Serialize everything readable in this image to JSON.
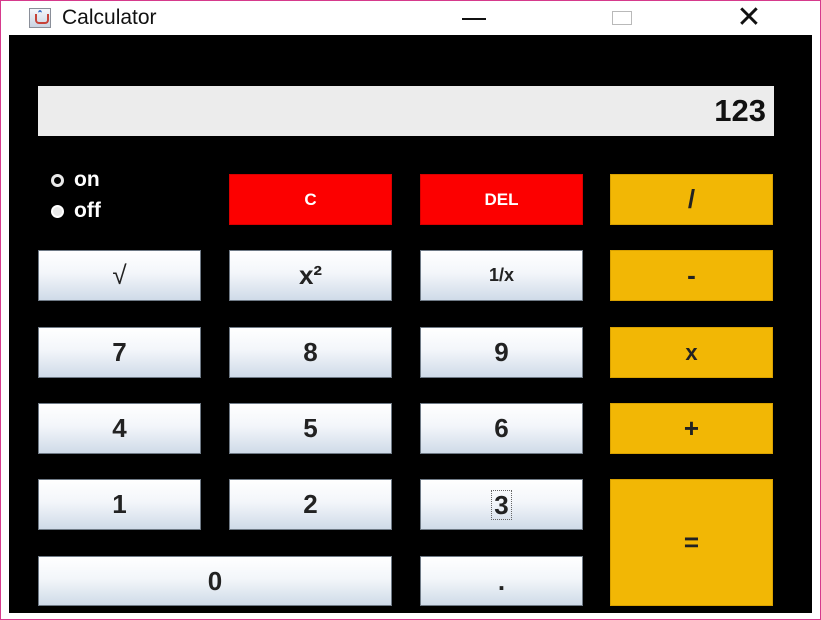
{
  "window": {
    "title": "Calculator",
    "minimize_glyph": "",
    "close_glyph": "✕"
  },
  "display": {
    "value": "123"
  },
  "power": {
    "on_label": "on",
    "off_label": "off",
    "selected": "off"
  },
  "buttons": {
    "clear": "C",
    "delete": "DEL",
    "divide": "/",
    "sqrt": "√",
    "square": "x²",
    "reciprocal": "1/x",
    "subtract": "-",
    "seven": "7",
    "eight": "8",
    "nine": "9",
    "multiply": "x",
    "four": "4",
    "five": "5",
    "six": "6",
    "add": "+",
    "one": "1",
    "two": "2",
    "three": "3",
    "equals": "=",
    "zero": "0",
    "decimal": "."
  },
  "colors": {
    "accent_red": "#fc0000",
    "accent_yellow": "#f2b705",
    "background": "#000000",
    "display_bg": "#ececec"
  }
}
